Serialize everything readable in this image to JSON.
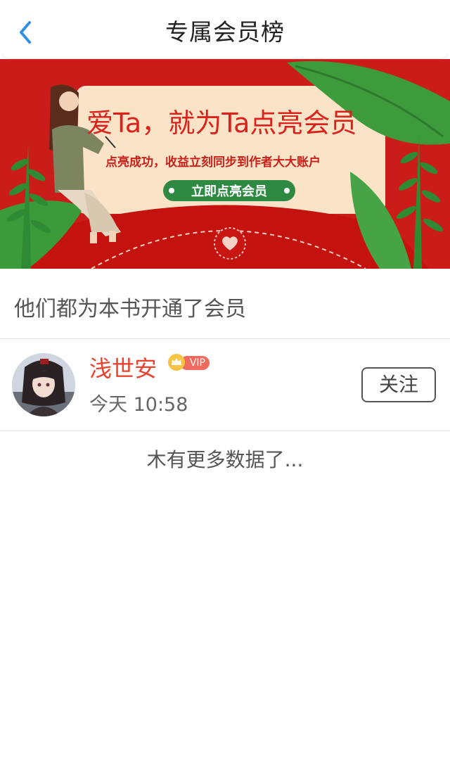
{
  "navbar": {
    "title": "专属会员榜",
    "back_icon": "chevron-left-icon",
    "accent_color": "#2f8fe0"
  },
  "banner": {
    "headline": "爱Ta，就为Ta点亮会员",
    "subline": "点亮成功，收益立刻同步到作者大大账户",
    "cta_label": "立即点亮会员",
    "background_color": "#d0211c"
  },
  "section": {
    "title": "他们都为本书开通了会员"
  },
  "members": [
    {
      "name": "浅世安",
      "badge": "VIP",
      "time": "今天 10:58",
      "follow_label": "关注"
    }
  ],
  "footer": {
    "no_more_text": "木有更多数据了..."
  }
}
